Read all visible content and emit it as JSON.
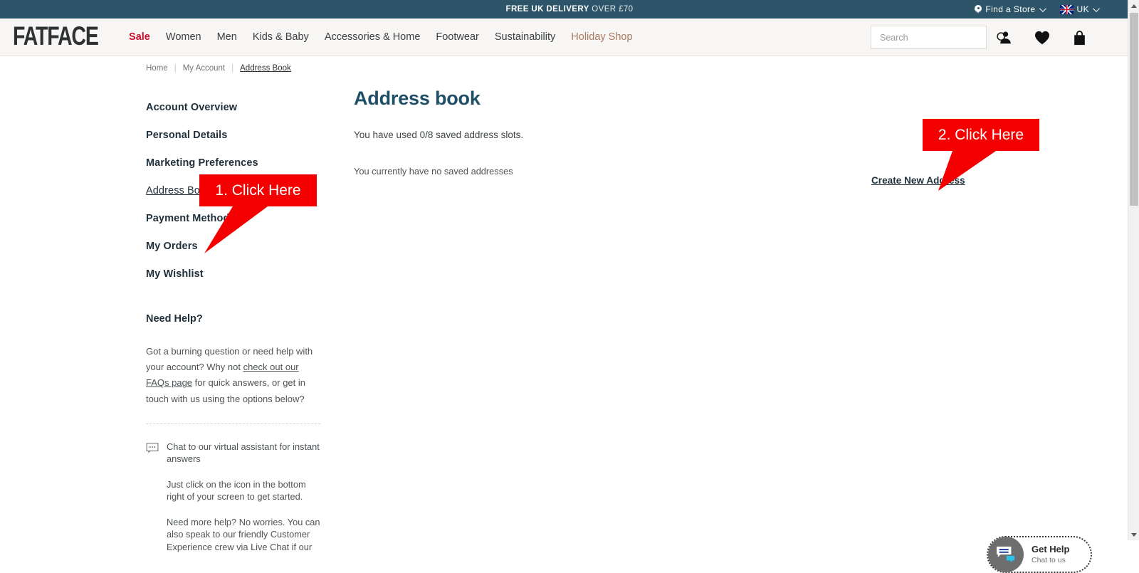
{
  "promo": {
    "bold": "FREE UK DELIVERY",
    "rest": " OVER £70",
    "find_store": "Find a Store",
    "pin_icon": "map-pin-icon",
    "chevron_icon": "chevron-down-icon",
    "country": "UK",
    "flag_icon": "uk-flag-icon",
    "bg_color": "#2d5468"
  },
  "header": {
    "logo": "FATFACE",
    "nav": [
      {
        "label": "Sale",
        "style": "sale"
      },
      {
        "label": "Women",
        "style": ""
      },
      {
        "label": "Men",
        "style": ""
      },
      {
        "label": "Kids & Baby",
        "style": ""
      },
      {
        "label": "Accessories & Home",
        "style": ""
      },
      {
        "label": "Footwear",
        "style": ""
      },
      {
        "label": "Sustainability",
        "style": ""
      },
      {
        "label": "Holiday Shop",
        "style": "holiday"
      }
    ],
    "search_placeholder": "Search",
    "search_value": "",
    "search_icon": "search-icon",
    "account_icon": "user-icon",
    "wishlist_icon": "heart-icon",
    "bag_icon": "shopping-bag-icon",
    "sale_color": "#c8102e",
    "holiday_color": "#a87a5f",
    "bg_color": "#f7f6f4"
  },
  "breadcrumb": [
    {
      "label": "Home",
      "current": false
    },
    {
      "label": "My Account",
      "current": false
    },
    {
      "label": "Address Book",
      "current": true
    }
  ],
  "breadcrumb_separator": "|",
  "sidebar": {
    "items": [
      {
        "label": "Account Overview",
        "active": false
      },
      {
        "label": "Personal Details",
        "active": false
      },
      {
        "label": "Marketing Preferences",
        "active": false
      },
      {
        "label": "Address Book",
        "active": true
      },
      {
        "label": "Payment Methods",
        "active": false
      },
      {
        "label": "My Orders",
        "active": false
      },
      {
        "label": "My Wishlist",
        "active": false
      }
    ],
    "need_help_title": "Need Help?",
    "help_text_before": "Got a burning question or need help with your account? Why not ",
    "help_link": "check out our FAQs page",
    "help_text_after": " for quick answers, or get in touch with us using the options below?",
    "chat_icon": "chat-bubble-icon",
    "chat_paragraphs": [
      "Chat to our virtual assistant for instant answers",
      "Just click on the icon in the bottom right of your screen to get started.",
      "Need more help? No worries. You can also speak to our friendly Customer Experience crew via Live Chat if our"
    ]
  },
  "main": {
    "title": "Address book",
    "title_color": "#1f4f66",
    "slots_text": "You have used 0/8 saved address slots.",
    "empty_text": "You currently have no saved addresses",
    "create_link": "Create New Address"
  },
  "callouts": [
    {
      "label": "1. Click Here",
      "color": "#f40000"
    },
    {
      "label": "2. Click Here",
      "color": "#f40000"
    }
  ],
  "get_help": {
    "title": "Get Help",
    "subtitle": "Chat to us",
    "icon": "chat-bubbles-icon"
  },
  "scrollbar": {
    "up_icon": "triangle-up-icon",
    "down_icon": "triangle-down-icon"
  }
}
